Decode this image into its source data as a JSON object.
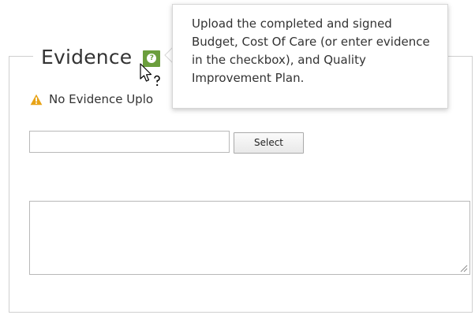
{
  "section": {
    "legend": "Evidence"
  },
  "help": {
    "icon": "question-icon",
    "tooltip_text": "Upload the completed and signed Budget, Cost Of Care (or enter evidence in the checkbox), and Quality Improvement Plan."
  },
  "warning": {
    "icon": "warning-triangle-icon",
    "text": "No Evidence Uplo",
    "color": "#e8a317"
  },
  "file_upload": {
    "value": "",
    "button_label": "Select"
  },
  "notes": {
    "value": ""
  },
  "colors": {
    "help_icon_bg": "#6b9e3c",
    "border": "#cfcfcf"
  }
}
